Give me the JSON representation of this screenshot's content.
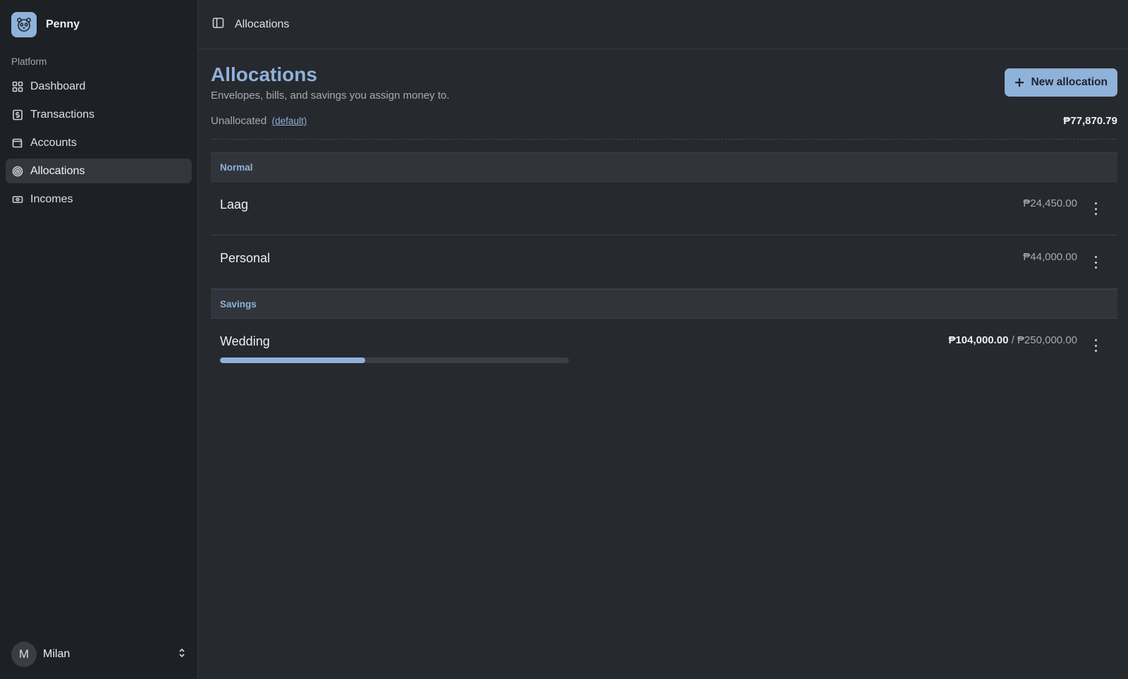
{
  "app": {
    "name": "Penny"
  },
  "sidebar": {
    "section_label": "Platform",
    "items": [
      {
        "label": "Dashboard",
        "icon": "grid-icon",
        "active": false
      },
      {
        "label": "Transactions",
        "icon": "dollar-receipt-icon",
        "active": false
      },
      {
        "label": "Accounts",
        "icon": "wallet-icon",
        "active": false
      },
      {
        "label": "Allocations",
        "icon": "target-icon",
        "active": true
      },
      {
        "label": "Incomes",
        "icon": "banknote-icon",
        "active": false
      }
    ],
    "user": {
      "initial": "M",
      "name": "Milan"
    }
  },
  "topbar": {
    "title": "Allocations"
  },
  "page": {
    "title": "Allocations",
    "subtitle": "Envelopes, bills, and savings you assign money to.",
    "new_button_label": "New allocation"
  },
  "unallocated": {
    "label": "Unallocated",
    "default_link": "(default)",
    "amount": "₱77,870.79"
  },
  "groups": [
    {
      "name": "Normal",
      "items": [
        {
          "name": "Laag",
          "amount": "₱24,450.00"
        },
        {
          "name": "Personal",
          "amount": "₱44,000.00"
        }
      ]
    },
    {
      "name": "Savings",
      "items": [
        {
          "name": "Wedding",
          "current": "₱104,000.00",
          "separator": "/",
          "target": "₱250,000.00",
          "progress": 0.416
        }
      ]
    }
  ],
  "colors": {
    "accent": "#8fb2d9",
    "background": "#26292e",
    "sidebar": "#1d2024"
  }
}
